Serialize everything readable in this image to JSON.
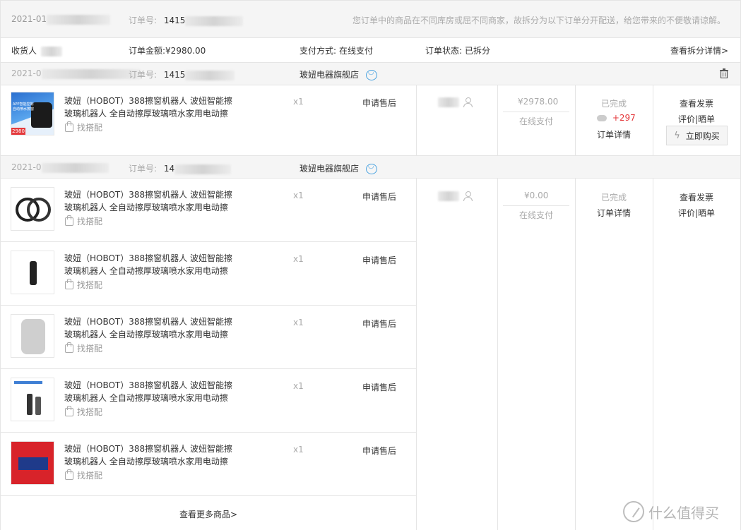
{
  "header": {
    "date_prefix": "2021-01",
    "order_no_label": "订单号:",
    "order_no_prefix": "1415",
    "notice": "您订单中的商品在不同库房或屈不同商家，故拆分为以下订单分开配送，给您带来的不便敬请谅解。"
  },
  "summary": {
    "receiver_label": "收货人",
    "amount_label": "订单金额:",
    "amount_value": "¥2980.00",
    "payment_label": "支付方式:",
    "payment_value": "在线支付",
    "status_label": "订单状态:",
    "status_value": "已拆分",
    "split_detail_link": "查看拆分详情>"
  },
  "order1": {
    "date_prefix": "2021-0",
    "order_no_label": "订单号:",
    "order_no_prefix": "1415",
    "shop": "玻妞电器旗舰店",
    "product": {
      "title": "玻妞（HOBOT）388擦窗机器人 波妞智能擦玻璃机器人 全自动擦厚玻璃喷水家用电动擦",
      "pair_label": "找搭配",
      "qty": "x1",
      "after_sale": "申请售后",
      "thumb_text_1": "APP智能控制",
      "thumb_text_2": "自动喷水擦窗",
      "thumb_price": "2980"
    },
    "price": "¥2978.00",
    "pay_method": "在线支付",
    "status": "已完成",
    "points": "+297",
    "detail_link": "订单详情",
    "invoice_link": "查看发票",
    "review_link": "评价|晒单",
    "buy_again": "立即购买"
  },
  "order2": {
    "date_prefix": "2021-0",
    "order_no_label": "订单号:",
    "order_no_prefix": "14",
    "shop": "玻妞电器旗舰店",
    "price": "¥0.00",
    "pay_method": "在线支付",
    "status": "已完成",
    "detail_link": "订单详情",
    "invoice_link": "查看发票",
    "review_link": "评价|晒单",
    "more_link": "查看更多商品>",
    "items": [
      {
        "title": "玻妞（HOBOT）388擦窗机器人 波妞智能擦玻璃机器人 全自动擦厚玻璃喷水家用电动擦",
        "pair_label": "找搭配",
        "qty": "x1",
        "after_sale": "申请售后"
      },
      {
        "title": "玻妞（HOBOT）388擦窗机器人 波妞智能擦玻璃机器人 全自动擦厚玻璃喷水家用电动擦",
        "pair_label": "找搭配",
        "qty": "x1",
        "after_sale": "申请售后"
      },
      {
        "title": "玻妞（HOBOT）388擦窗机器人 波妞智能擦玻璃机器人 全自动擦厚玻璃喷水家用电动擦",
        "pair_label": "找搭配",
        "qty": "x1",
        "after_sale": "申请售后"
      },
      {
        "title": "玻妞（HOBOT）388擦窗机器人 波妞智能擦玻璃机器人 全自动擦厚玻璃喷水家用电动擦",
        "pair_label": "找搭配",
        "qty": "x1",
        "after_sale": "申请售后"
      },
      {
        "title": "玻妞（HOBOT）388擦窗机器人 波妞智能擦玻璃机器人 全自动擦厚玻璃喷水家用电动擦",
        "pair_label": "找搭配",
        "qty": "x1",
        "after_sale": "申请售后"
      }
    ]
  },
  "watermark": {
    "text": "什么值得买",
    "icon": "smzdm-logo-icon"
  },
  "colors": {
    "accent_red": "#e4393c",
    "header_bg": "#f5f5f5",
    "border": "#e5e5e5",
    "chat_blue": "#4aa3e0"
  }
}
